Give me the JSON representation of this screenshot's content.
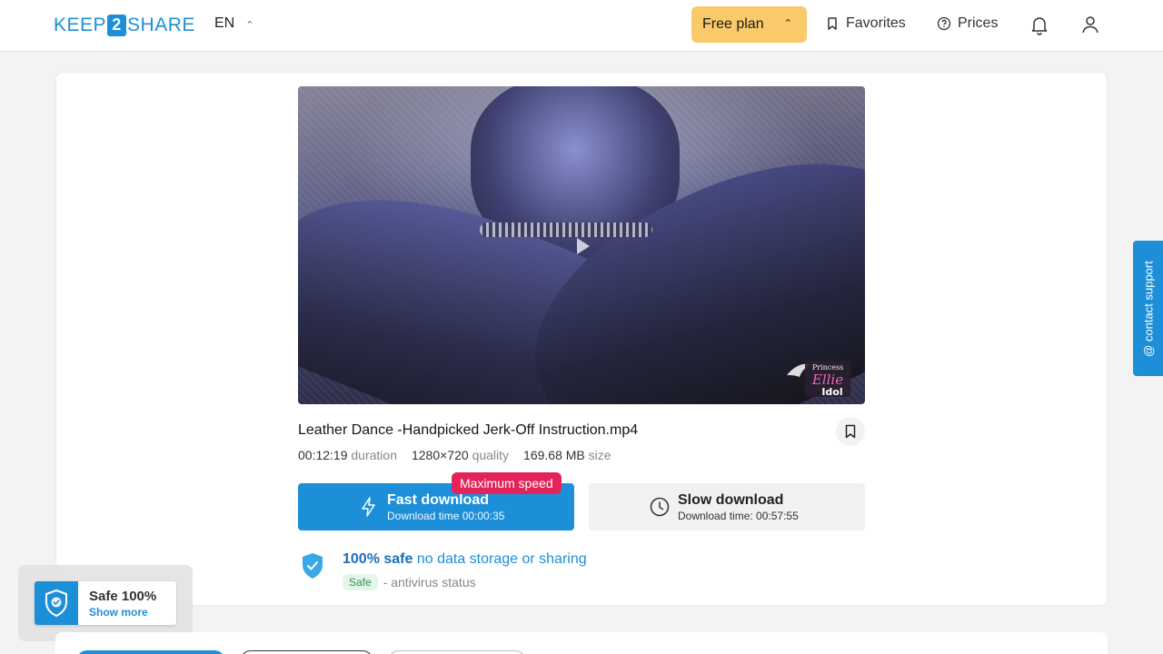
{
  "header": {
    "logo_left": "KEEP",
    "logo_mid": "2",
    "logo_right": "SHARE",
    "language": "EN",
    "plan_label": "Free plan",
    "favorites_label": "Favorites",
    "prices_label": "Prices"
  },
  "file": {
    "title": "Leather Dance -Handpicked Jerk-Off Instruction.mp4",
    "duration_value": "00:12:19",
    "duration_label": "duration",
    "quality_value": "1280×720",
    "quality_label": "quality",
    "size_value": "169.68 MB",
    "size_label": "size",
    "watermark_line1": "Princess",
    "watermark_line2": "Ellie",
    "watermark_line3": "Idol"
  },
  "download": {
    "badge": "Maximum speed",
    "fast_label": "Fast download",
    "fast_time": "Download time 00:00:35",
    "slow_label": "Slow download",
    "slow_time": "Download time: 00:57:55"
  },
  "safety": {
    "bold": "100% safe",
    "rest": "no data storage or sharing",
    "badge": "Safe",
    "status": "- antivirus status"
  },
  "support": {
    "label": "@ contact support"
  },
  "widget": {
    "title": "Safe 100%",
    "link": "Show more"
  },
  "colors": {
    "brand": "#1d8fd8",
    "plan": "#f9c96a",
    "badge": "#e2245a"
  }
}
